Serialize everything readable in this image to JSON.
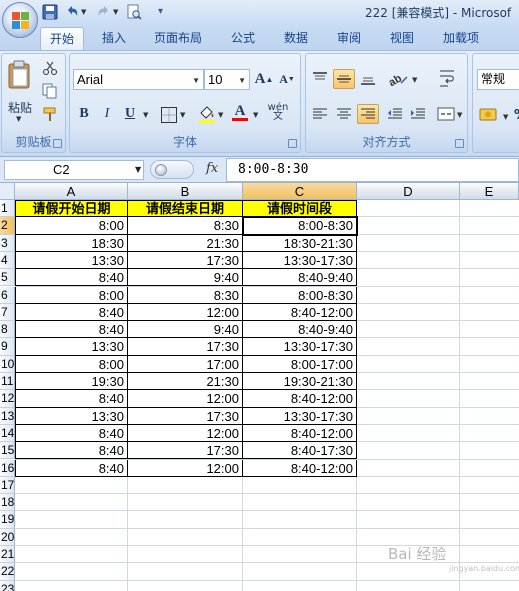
{
  "window": {
    "title": "222  [兼容模式] - Microsof"
  },
  "tabs": [
    "开始",
    "插入",
    "页面布局",
    "公式",
    "数据",
    "审阅",
    "视图",
    "加载项"
  ],
  "active_tab": "开始",
  "ribbon": {
    "clipboard": {
      "label": "剪贴板",
      "paste_label": "粘贴"
    },
    "font": {
      "label": "字体",
      "font_name": "Arial",
      "font_size": "10",
      "grow_label": "A",
      "shrink_label": "A",
      "bold": "B",
      "italic": "I",
      "underline": "U",
      "font_color_label": "A",
      "phonetic_label": "wén 文"
    },
    "alignment": {
      "label": "对齐方式"
    },
    "number": {
      "format": "常规"
    }
  },
  "formula_bar": {
    "name_box": "C2",
    "fx_label": "fx",
    "formula": "8:00-8:30"
  },
  "sheet": {
    "columns": [
      "A",
      "B",
      "C",
      "D",
      "E"
    ],
    "selected_column": "C",
    "selected_row": "2",
    "rows": [
      "1",
      "2",
      "3",
      "4",
      "5",
      "6",
      "7",
      "8",
      "9",
      "10",
      "11",
      "12",
      "13",
      "14",
      "15",
      "16",
      "17",
      "18",
      "19",
      "20",
      "21",
      "22",
      "23"
    ],
    "header_row": [
      "请假开始日期",
      "请假结束日期",
      "请假时间段"
    ],
    "data": [
      [
        "8:00",
        "8:30",
        "8:00-8:30"
      ],
      [
        "18:30",
        "21:30",
        "18:30-21:30"
      ],
      [
        "13:30",
        "17:30",
        "13:30-17:30"
      ],
      [
        "8:40",
        "9:40",
        "8:40-9:40"
      ],
      [
        "8:00",
        "8:30",
        "8:00-8:30"
      ],
      [
        "8:40",
        "12:00",
        "8:40-12:00"
      ],
      [
        "8:40",
        "9:40",
        "8:40-9:40"
      ],
      [
        "13:30",
        "17:30",
        "13:30-17:30"
      ],
      [
        "8:00",
        "17:00",
        "8:00-17:00"
      ],
      [
        "19:30",
        "21:30",
        "19:30-21:30"
      ],
      [
        "8:40",
        "12:00",
        "8:40-12:00"
      ],
      [
        "13:30",
        "17:30",
        "13:30-17:30"
      ],
      [
        "8:40",
        "12:00",
        "8:40-12:00"
      ],
      [
        "8:40",
        "17:30",
        "8:40-17:30"
      ],
      [
        "8:40",
        "12:00",
        "8:40-12:00"
      ]
    ]
  },
  "watermark": {
    "text": "Bai 经验",
    "sub": "jingyan.baidu.com"
  },
  "colors": {
    "header_fill": "#ffff00",
    "selection_header": "#f1c15f",
    "ribbon_bg": "#dbe7f6"
  }
}
